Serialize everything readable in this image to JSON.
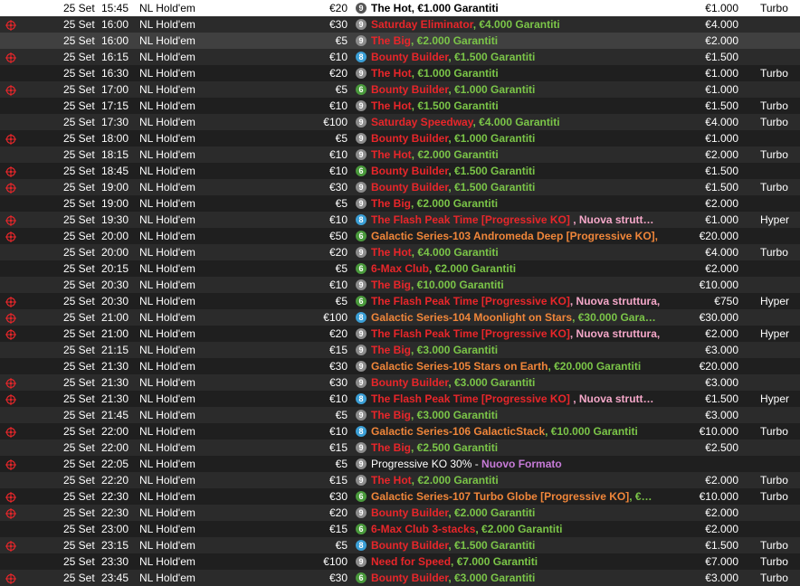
{
  "colors": {
    "red": "#e8262a",
    "green": "#7bc548",
    "orange": "#f0863a",
    "pink": "#f4a7c8",
    "purple": "#c77bd8",
    "white": "#ffffff",
    "black": "#000000"
  },
  "rows": [
    {
      "bounty": false,
      "date": "25 Set",
      "time": "15:45",
      "game": "NL Hold'em",
      "buyin": "€20",
      "seats": "9",
      "name": "The Hot",
      "name_color": "black",
      "ext": ", €1.000 Garantiti",
      "ext_color": "black",
      "prize": "€1.000",
      "speed": "Turbo",
      "state": "selected"
    },
    {
      "bounty": true,
      "date": "25 Set",
      "time": "16:00",
      "game": "NL Hold'em",
      "buyin": "€30",
      "seats": "9",
      "name": "Saturday Eliminator",
      "name_color": "red",
      "ext": ", €4.000 Garantiti",
      "ext_color": "green",
      "prize": "€4.000",
      "speed": "",
      "state": ""
    },
    {
      "bounty": false,
      "date": "25 Set",
      "time": "16:00",
      "game": "NL Hold'em",
      "buyin": "€5",
      "seats": "9",
      "name": "The Big",
      "name_color": "red",
      "ext": ", €2.000 Garantiti",
      "ext_color": "green",
      "prize": "€2.000",
      "speed": "",
      "state": "highlight"
    },
    {
      "bounty": true,
      "date": "25 Set",
      "time": "16:15",
      "game": "NL Hold'em",
      "buyin": "€10",
      "seats": "8",
      "name": "Bounty Builder",
      "name_color": "red",
      "ext": ", €1.500 Garantiti",
      "ext_color": "green",
      "prize": "€1.500",
      "speed": "",
      "state": ""
    },
    {
      "bounty": false,
      "date": "25 Set",
      "time": "16:30",
      "game": "NL Hold'em",
      "buyin": "€20",
      "seats": "9",
      "name": "The Hot",
      "name_color": "red",
      "ext": ", €1.000 Garantiti",
      "ext_color": "green",
      "prize": "€1.000",
      "speed": "Turbo",
      "state": ""
    },
    {
      "bounty": true,
      "date": "25 Set",
      "time": "17:00",
      "game": "NL Hold'em",
      "buyin": "€5",
      "seats": "6",
      "name": "Bounty Builder",
      "name_color": "red",
      "ext": ", €1.000 Garantiti",
      "ext_color": "green",
      "prize": "€1.000",
      "speed": "",
      "state": ""
    },
    {
      "bounty": false,
      "date": "25 Set",
      "time": "17:15",
      "game": "NL Hold'em",
      "buyin": "€10",
      "seats": "9",
      "name": "The Hot",
      "name_color": "red",
      "ext": ", €1.500 Garantiti",
      "ext_color": "green",
      "prize": "€1.500",
      "speed": "Turbo",
      "state": ""
    },
    {
      "bounty": false,
      "date": "25 Set",
      "time": "17:30",
      "game": "NL Hold'em",
      "buyin": "€100",
      "seats": "9",
      "name": "Saturday Speedway",
      "name_color": "red",
      "ext": ", €4.000 Garantiti",
      "ext_color": "green",
      "prize": "€4.000",
      "speed": "Turbo",
      "state": ""
    },
    {
      "bounty": true,
      "date": "25 Set",
      "time": "18:00",
      "game": "NL Hold'em",
      "buyin": "€5",
      "seats": "9",
      "name": "Bounty Builder",
      "name_color": "red",
      "ext": ", €1.000 Garantiti",
      "ext_color": "green",
      "prize": "€1.000",
      "speed": "",
      "state": ""
    },
    {
      "bounty": false,
      "date": "25 Set",
      "time": "18:15",
      "game": "NL Hold'em",
      "buyin": "€10",
      "seats": "9",
      "name": "The Hot",
      "name_color": "red",
      "ext": ", €2.000 Garantiti",
      "ext_color": "green",
      "prize": "€2.000",
      "speed": "Turbo",
      "state": ""
    },
    {
      "bounty": true,
      "date": "25 Set",
      "time": "18:45",
      "game": "NL Hold'em",
      "buyin": "€10",
      "seats": "6",
      "name": "Bounty Builder",
      "name_color": "red",
      "ext": ", €1.500 Garantiti",
      "ext_color": "green",
      "prize": "€1.500",
      "speed": "",
      "state": ""
    },
    {
      "bounty": true,
      "date": "25 Set",
      "time": "19:00",
      "game": "NL Hold'em",
      "buyin": "€30",
      "seats": "9",
      "name": "Bounty Builder",
      "name_color": "red",
      "ext": ", €1.500 Garantiti",
      "ext_color": "green",
      "prize": "€1.500",
      "speed": "Turbo",
      "state": ""
    },
    {
      "bounty": false,
      "date": "25 Set",
      "time": "19:00",
      "game": "NL Hold'em",
      "buyin": "€5",
      "seats": "9",
      "name": "The Big",
      "name_color": "red",
      "ext": ", €2.000 Garantiti",
      "ext_color": "green",
      "prize": "€2.000",
      "speed": "",
      "state": ""
    },
    {
      "bounty": true,
      "date": "25 Set",
      "time": "19:30",
      "game": "NL Hold'em",
      "buyin": "€10",
      "seats": "8",
      "name": "The Flash Peak Time [Progressive KO]",
      "name_color": "red",
      "ext": " , Nuova strutt…",
      "ext_color": "pink",
      "prize": "€1.000",
      "speed": "Hyper",
      "state": ""
    },
    {
      "bounty": true,
      "date": "25 Set",
      "time": "20:00",
      "game": "NL Hold'em",
      "buyin": "€50",
      "seats": "6",
      "name": "Galactic Series-103 Andromeda Deep [Progressive KO],",
      "name_color": "orange",
      "ext": "",
      "ext_color": "orange",
      "prize": "€20.000",
      "speed": "",
      "state": ""
    },
    {
      "bounty": false,
      "date": "25 Set",
      "time": "20:00",
      "game": "NL Hold'em",
      "buyin": "€20",
      "seats": "9",
      "name": "The Hot",
      "name_color": "red",
      "ext": ", €4.000 Garantiti",
      "ext_color": "green",
      "prize": "€4.000",
      "speed": "Turbo",
      "state": ""
    },
    {
      "bounty": false,
      "date": "25 Set",
      "time": "20:15",
      "game": "NL Hold'em",
      "buyin": "€5",
      "seats": "6",
      "name": "6-Max Club",
      "name_color": "red",
      "ext": ", €2.000 Garantiti",
      "ext_color": "green",
      "prize": "€2.000",
      "speed": "",
      "state": ""
    },
    {
      "bounty": false,
      "date": "25 Set",
      "time": "20:30",
      "game": "NL Hold'em",
      "buyin": "€10",
      "seats": "9",
      "name": "The Big",
      "name_color": "red",
      "ext": ", €10.000 Garantiti",
      "ext_color": "green",
      "prize": "€10.000",
      "speed": "",
      "state": ""
    },
    {
      "bounty": true,
      "date": "25 Set",
      "time": "20:30",
      "game": "NL Hold'em",
      "buyin": "€5",
      "seats": "6",
      "name": "The Flash Peak Time [Progressive KO]",
      "name_color": "red",
      "ext": ", Nuova struttura,",
      "ext_color": "pink",
      "prize": "€750",
      "speed": "Hyper",
      "state": ""
    },
    {
      "bounty": true,
      "date": "25 Set",
      "time": "21:00",
      "game": "NL Hold'em",
      "buyin": "€100",
      "seats": "8",
      "name": "Galactic Series-104 Moonlight on Stars",
      "name_color": "orange",
      "ext": ", €30.000 Gara…",
      "ext_color": "green",
      "prize": "€30.000",
      "speed": "",
      "state": ""
    },
    {
      "bounty": true,
      "date": "25 Set",
      "time": "21:00",
      "game": "NL Hold'em",
      "buyin": "€20",
      "seats": "9",
      "name": "The Flash Peak Time [Progressive KO]",
      "name_color": "red",
      "ext": ", Nuova struttura,",
      "ext_color": "pink",
      "prize": "€2.000",
      "speed": "Hyper",
      "state": ""
    },
    {
      "bounty": false,
      "date": "25 Set",
      "time": "21:15",
      "game": "NL Hold'em",
      "buyin": "€15",
      "seats": "9",
      "name": "The Big",
      "name_color": "red",
      "ext": ", €3.000 Garantiti",
      "ext_color": "green",
      "prize": "€3.000",
      "speed": "",
      "state": ""
    },
    {
      "bounty": false,
      "date": "25 Set",
      "time": "21:30",
      "game": "NL Hold'em",
      "buyin": "€30",
      "seats": "9",
      "name": "Galactic Series-105 Stars on Earth",
      "name_color": "orange",
      "ext": ", €20.000 Garantiti",
      "ext_color": "green",
      "prize": "€20.000",
      "speed": "",
      "state": ""
    },
    {
      "bounty": true,
      "date": "25 Set",
      "time": "21:30",
      "game": "NL Hold'em",
      "buyin": "€30",
      "seats": "9",
      "name": "Bounty Builder",
      "name_color": "red",
      "ext": ", €3.000 Garantiti",
      "ext_color": "green",
      "prize": "€3.000",
      "speed": "",
      "state": ""
    },
    {
      "bounty": true,
      "date": "25 Set",
      "time": "21:30",
      "game": "NL Hold'em",
      "buyin": "€10",
      "seats": "8",
      "name": "The Flash Peak Time [Progressive KO]",
      "name_color": "red",
      "ext": " , Nuova strutt…",
      "ext_color": "pink",
      "prize": "€1.500",
      "speed": "Hyper",
      "state": ""
    },
    {
      "bounty": false,
      "date": "25 Set",
      "time": "21:45",
      "game": "NL Hold'em",
      "buyin": "€5",
      "seats": "9",
      "name": "The Big",
      "name_color": "red",
      "ext": ", €3.000 Garantiti",
      "ext_color": "green",
      "prize": "€3.000",
      "speed": "",
      "state": ""
    },
    {
      "bounty": true,
      "date": "25 Set",
      "time": "22:00",
      "game": "NL Hold'em",
      "buyin": "€10",
      "seats": "8",
      "name": "Galactic Series-106 GalacticStack",
      "name_color": "orange",
      "ext": ", €10.000 Garantiti",
      "ext_color": "green",
      "prize": "€10.000",
      "speed": "Turbo",
      "state": ""
    },
    {
      "bounty": false,
      "date": "25 Set",
      "time": "22:00",
      "game": "NL Hold'em",
      "buyin": "€15",
      "seats": "9",
      "name": "The Big",
      "name_color": "red",
      "ext": ", €2.500 Garantiti",
      "ext_color": "green",
      "prize": "€2.500",
      "speed": "",
      "state": ""
    },
    {
      "bounty": true,
      "date": "25 Set",
      "time": "22:05",
      "game": "NL Hold'em",
      "buyin": "€5",
      "seats": "9",
      "name": "Progressive KO 30% - ",
      "name_color": "white",
      "ext": "Nuovo Formato",
      "ext_color": "purple",
      "prize": "",
      "speed": "",
      "state": ""
    },
    {
      "bounty": false,
      "date": "25 Set",
      "time": "22:20",
      "game": "NL Hold'em",
      "buyin": "€15",
      "seats": "9",
      "name": "The Hot",
      "name_color": "red",
      "ext": ", €2.000 Garantiti",
      "ext_color": "green",
      "prize": "€2.000",
      "speed": "Turbo",
      "state": ""
    },
    {
      "bounty": true,
      "date": "25 Set",
      "time": "22:30",
      "game": "NL Hold'em",
      "buyin": "€30",
      "seats": "6",
      "name": "Galactic Series-107 Turbo Globe [Progressive KO]",
      "name_color": "orange",
      "ext": ", €…",
      "ext_color": "green",
      "prize": "€10.000",
      "speed": "Turbo",
      "state": ""
    },
    {
      "bounty": true,
      "date": "25 Set",
      "time": "22:30",
      "game": "NL Hold'em",
      "buyin": "€20",
      "seats": "9",
      "name": "Bounty Builder",
      "name_color": "red",
      "ext": ", €2.000 Garantiti",
      "ext_color": "green",
      "prize": "€2.000",
      "speed": "",
      "state": ""
    },
    {
      "bounty": false,
      "date": "25 Set",
      "time": "23:00",
      "game": "NL Hold'em",
      "buyin": "€15",
      "seats": "6",
      "name": "6-Max Club 3-stacks",
      "name_color": "red",
      "ext": ", €2.000 Garantiti",
      "ext_color": "green",
      "prize": "€2.000",
      "speed": "",
      "state": ""
    },
    {
      "bounty": true,
      "date": "25 Set",
      "time": "23:15",
      "game": "NL Hold'em",
      "buyin": "€5",
      "seats": "8",
      "name": "Bounty Builder",
      "name_color": "red",
      "ext": ", €1.500 Garantiti",
      "ext_color": "green",
      "prize": "€1.500",
      "speed": "Turbo",
      "state": ""
    },
    {
      "bounty": false,
      "date": "25 Set",
      "time": "23:30",
      "game": "NL Hold'em",
      "buyin": "€100",
      "seats": "9",
      "name": "Need for Speed",
      "name_color": "red",
      "ext": ", €7.000 Garantiti",
      "ext_color": "green",
      "prize": "€7.000",
      "speed": "Turbo",
      "state": ""
    },
    {
      "bounty": true,
      "date": "25 Set",
      "time": "23:45",
      "game": "NL Hold'em",
      "buyin": "€30",
      "seats": "6",
      "name": "Bounty Builder",
      "name_color": "red",
      "ext": ", €3.000 Garantiti",
      "ext_color": "green",
      "prize": "€3.000",
      "speed": "Turbo",
      "state": ""
    }
  ]
}
